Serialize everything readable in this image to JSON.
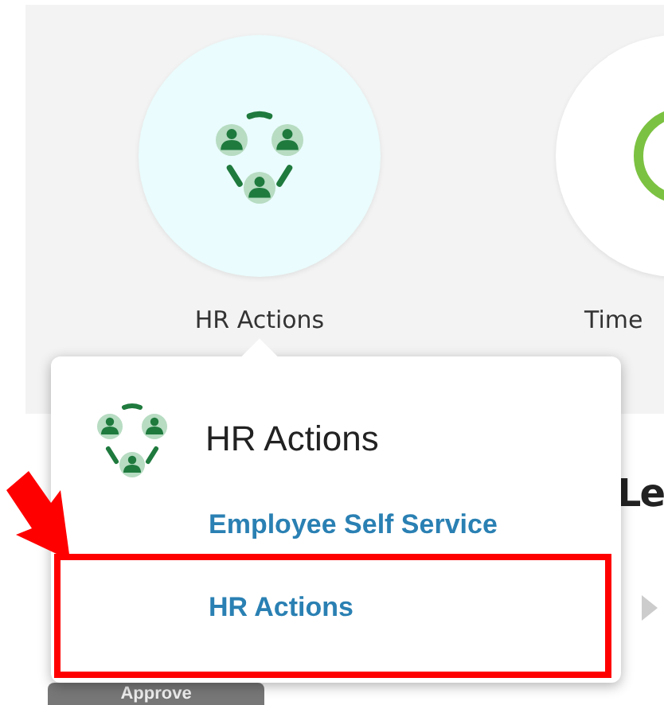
{
  "tiles": [
    {
      "label": "HR Actions",
      "selected": true,
      "kind": "people"
    },
    {
      "label": "Time",
      "selected": false,
      "kind": "clock"
    }
  ],
  "background": {
    "heading": "Le",
    "approve_button": "Approve"
  },
  "popup": {
    "title": "HR Actions",
    "links": [
      {
        "label": "Employee Self Service",
        "highlighted": false
      },
      {
        "label": "HR Actions",
        "highlighted": true
      }
    ]
  }
}
